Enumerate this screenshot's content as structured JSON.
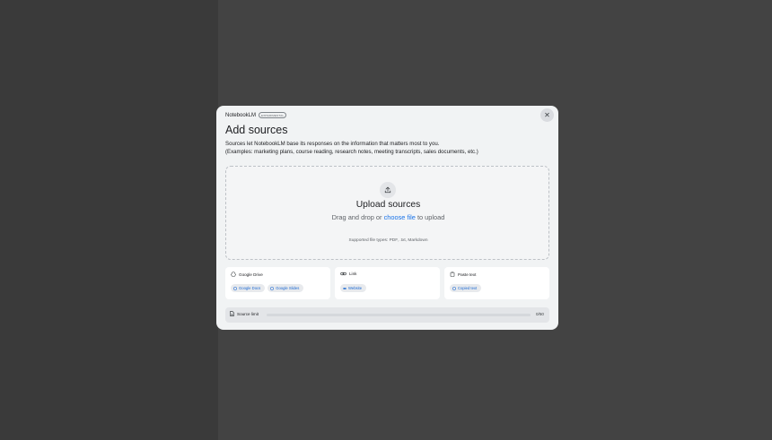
{
  "brand": {
    "name": "NotebookLM",
    "badge": "EXPERIMENTAL"
  },
  "dialog": {
    "title": "Add sources",
    "description_line1": "Sources let NotebookLM base its responses on the information that matters most to you.",
    "description_line2": "(Examples: marketing plans, course reading, research notes, meeting transcripts, sales documents, etc.)",
    "close_icon": "close-icon"
  },
  "upload": {
    "icon": "upload-icon",
    "title": "Upload sources",
    "prompt_before": "Drag and drop or ",
    "prompt_link": "choose file",
    "prompt_after": " to upload",
    "supported_types": "Supported file types: PDF, .txt, Markdown"
  },
  "cards": {
    "drive": {
      "title": "Google Drive",
      "icon": "google-drive-icon",
      "chips": [
        "Google Docs",
        "Google Slides"
      ]
    },
    "link": {
      "title": "Link",
      "icon": "link-icon",
      "chips": [
        "Website"
      ]
    },
    "paste": {
      "title": "Paste text",
      "icon": "clipboard-icon",
      "chips": [
        "Copied text"
      ]
    }
  },
  "limit": {
    "label": "Source limit",
    "count": "0/50",
    "progress": 0
  },
  "colors": {
    "accent": "#1a73e8",
    "backdrop": "#3c3c3c",
    "dialog_bg": "#f1f3f4"
  }
}
